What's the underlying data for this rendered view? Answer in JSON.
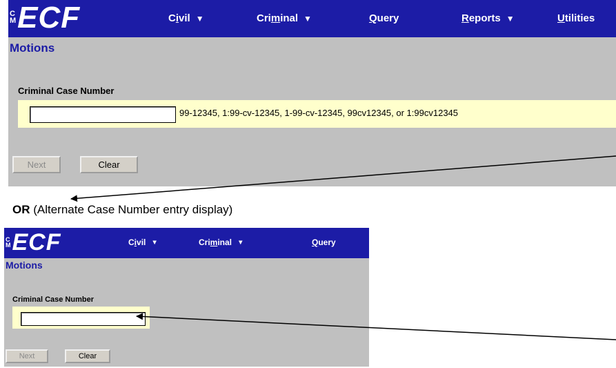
{
  "top_screen": {
    "logo": {
      "badge": [
        "C",
        "M"
      ],
      "text": "ECF"
    },
    "menu": [
      {
        "pre": "C",
        "u": "i",
        "post": "vil",
        "caret": "▼"
      },
      {
        "pre": "Cri",
        "u": "m",
        "post": "inal",
        "caret": "▼"
      },
      {
        "pre": "",
        "u": "Q",
        "post": "uery",
        "caret": ""
      },
      {
        "pre": "",
        "u": "R",
        "post": "eports",
        "caret": "▼"
      },
      {
        "pre": "",
        "u": "U",
        "post": "tilities",
        "caret": ""
      }
    ],
    "page_title": "Motions",
    "case_label": "Criminal Case Number",
    "case_value": "",
    "format_hint": "99-12345, 1:99-cv-12345, 1-99-cv-12345, 99cv12345, or 1:99cv12345",
    "next_label": "Next",
    "clear_label": "Clear"
  },
  "caption": {
    "bold": "OR",
    "rest": " (Alternate Case Number entry display)"
  },
  "bottom_screen": {
    "logo": {
      "badge": [
        "C",
        "M"
      ],
      "text": "ECF"
    },
    "menu": [
      {
        "pre": "C",
        "u": "i",
        "post": "vil",
        "caret": "▼"
      },
      {
        "pre": "Cri",
        "u": "m",
        "post": "inal",
        "caret": "▼"
      },
      {
        "pre": "",
        "u": "Q",
        "post": "uery",
        "caret": ""
      }
    ],
    "page_title": "Motions",
    "case_label": "Criminal Case Number",
    "case_value": "",
    "next_label": "Next",
    "clear_label": "Clear"
  },
  "colors": {
    "navbar": "#1c1ca6",
    "screen_bg": "#c0c0c0",
    "field_highlight": "#ffffcc"
  }
}
